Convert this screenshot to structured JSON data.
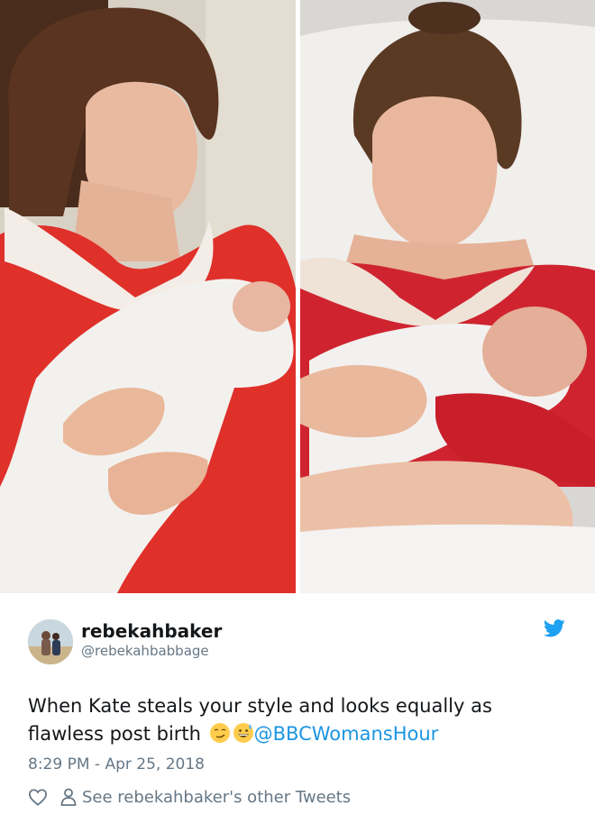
{
  "photos": [
    {
      "name": "left-photo",
      "icon": "photo-mother-red-dress-lace-collar-baby"
    },
    {
      "name": "right-photo",
      "icon": "photo-mother-hospital-bed-baby"
    }
  ],
  "tweet": {
    "display_name": "rebekahbaker",
    "handle": "@rebekahbabbage",
    "avatar_icon": "avatar",
    "brand_icon": "twitter-bird-icon",
    "text_part1": "When Kate steals your style and looks equally as flawless post birth ",
    "emoji_1": "smirking-face-emoji",
    "emoji_2": "grinning-sweat-emoji",
    "mention": "@BBCWomansHour",
    "timestamp": "8:29 PM - Apr 25, 2018",
    "see_more": "See rebekahbaker's other Tweets",
    "colors": {
      "link": "#1b95e0",
      "secondary_text": "#657786",
      "primary_text": "#14171a"
    }
  }
}
